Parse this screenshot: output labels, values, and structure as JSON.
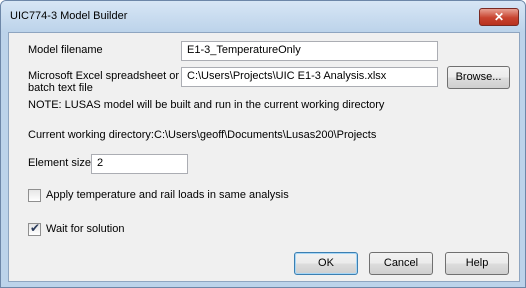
{
  "window": {
    "title": "UIC774-3 Model Builder",
    "close_label": "✕"
  },
  "form": {
    "model_filename_label": "Model filename",
    "model_filename_value": "E1-3_TemperatureOnly",
    "spreadsheet_label_line1": "Microsoft Excel spreadsheet or",
    "spreadsheet_label_line2": "batch text file",
    "spreadsheet_value": "C:\\Users\\Projects\\UIC E1-3 Analysis.xlsx",
    "browse_label": "Browse...",
    "note_text": "NOTE: LUSAS model will be built and run in the current working directory",
    "cwd_label": "Current working directory:",
    "cwd_value": "C:\\Users\\geoff\\Documents\\Lusas200\\Projects",
    "element_size_label": "Element size",
    "element_size_value": "2",
    "apply_loads_label": "Apply temperature and rail loads in same analysis",
    "apply_loads_checked": false,
    "wait_label": "Wait for solution",
    "wait_checked": true
  },
  "buttons": {
    "ok": "OK",
    "cancel": "Cancel",
    "help": "Help"
  }
}
